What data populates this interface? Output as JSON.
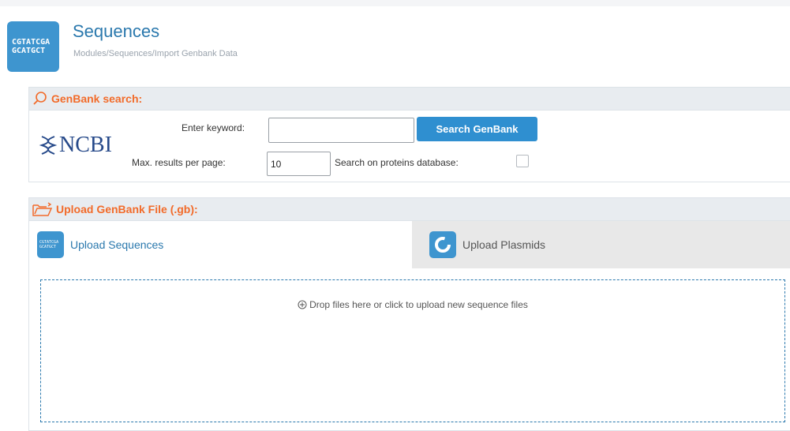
{
  "app": {
    "logo_line1": "CGTATCGA",
    "logo_line2": "GCATGCT",
    "title": "Sequences",
    "breadcrumb": "Modules/Sequences/Import Genbank Data"
  },
  "genbank_search": {
    "header": "GenBank search:",
    "logo_text": "NCBI",
    "keyword_label": "Enter keyword:",
    "keyword_value": "",
    "search_button": "Search GenBank",
    "max_results_label": "Max. results per page:",
    "max_results_value": "10",
    "proteins_label": "Search on proteins database:",
    "proteins_checked": false
  },
  "upload": {
    "header": "Upload GenBank File (.gb):",
    "tabs": [
      {
        "label": "Upload Sequences",
        "active": true
      },
      {
        "label": "Upload Plasmids",
        "active": false
      }
    ],
    "dropzone_text": "Drop files here or click to upload new sequence files"
  },
  "colors": {
    "accent": "#2a78ad",
    "header_orange": "#f26b2a",
    "button_blue": "#2f8fd0"
  },
  "icons": [
    "dna-logo-icon",
    "search-icon",
    "ncbi-helix-icon",
    "folder-upload-icon",
    "plasmid-icon",
    "plus-circle-icon"
  ]
}
